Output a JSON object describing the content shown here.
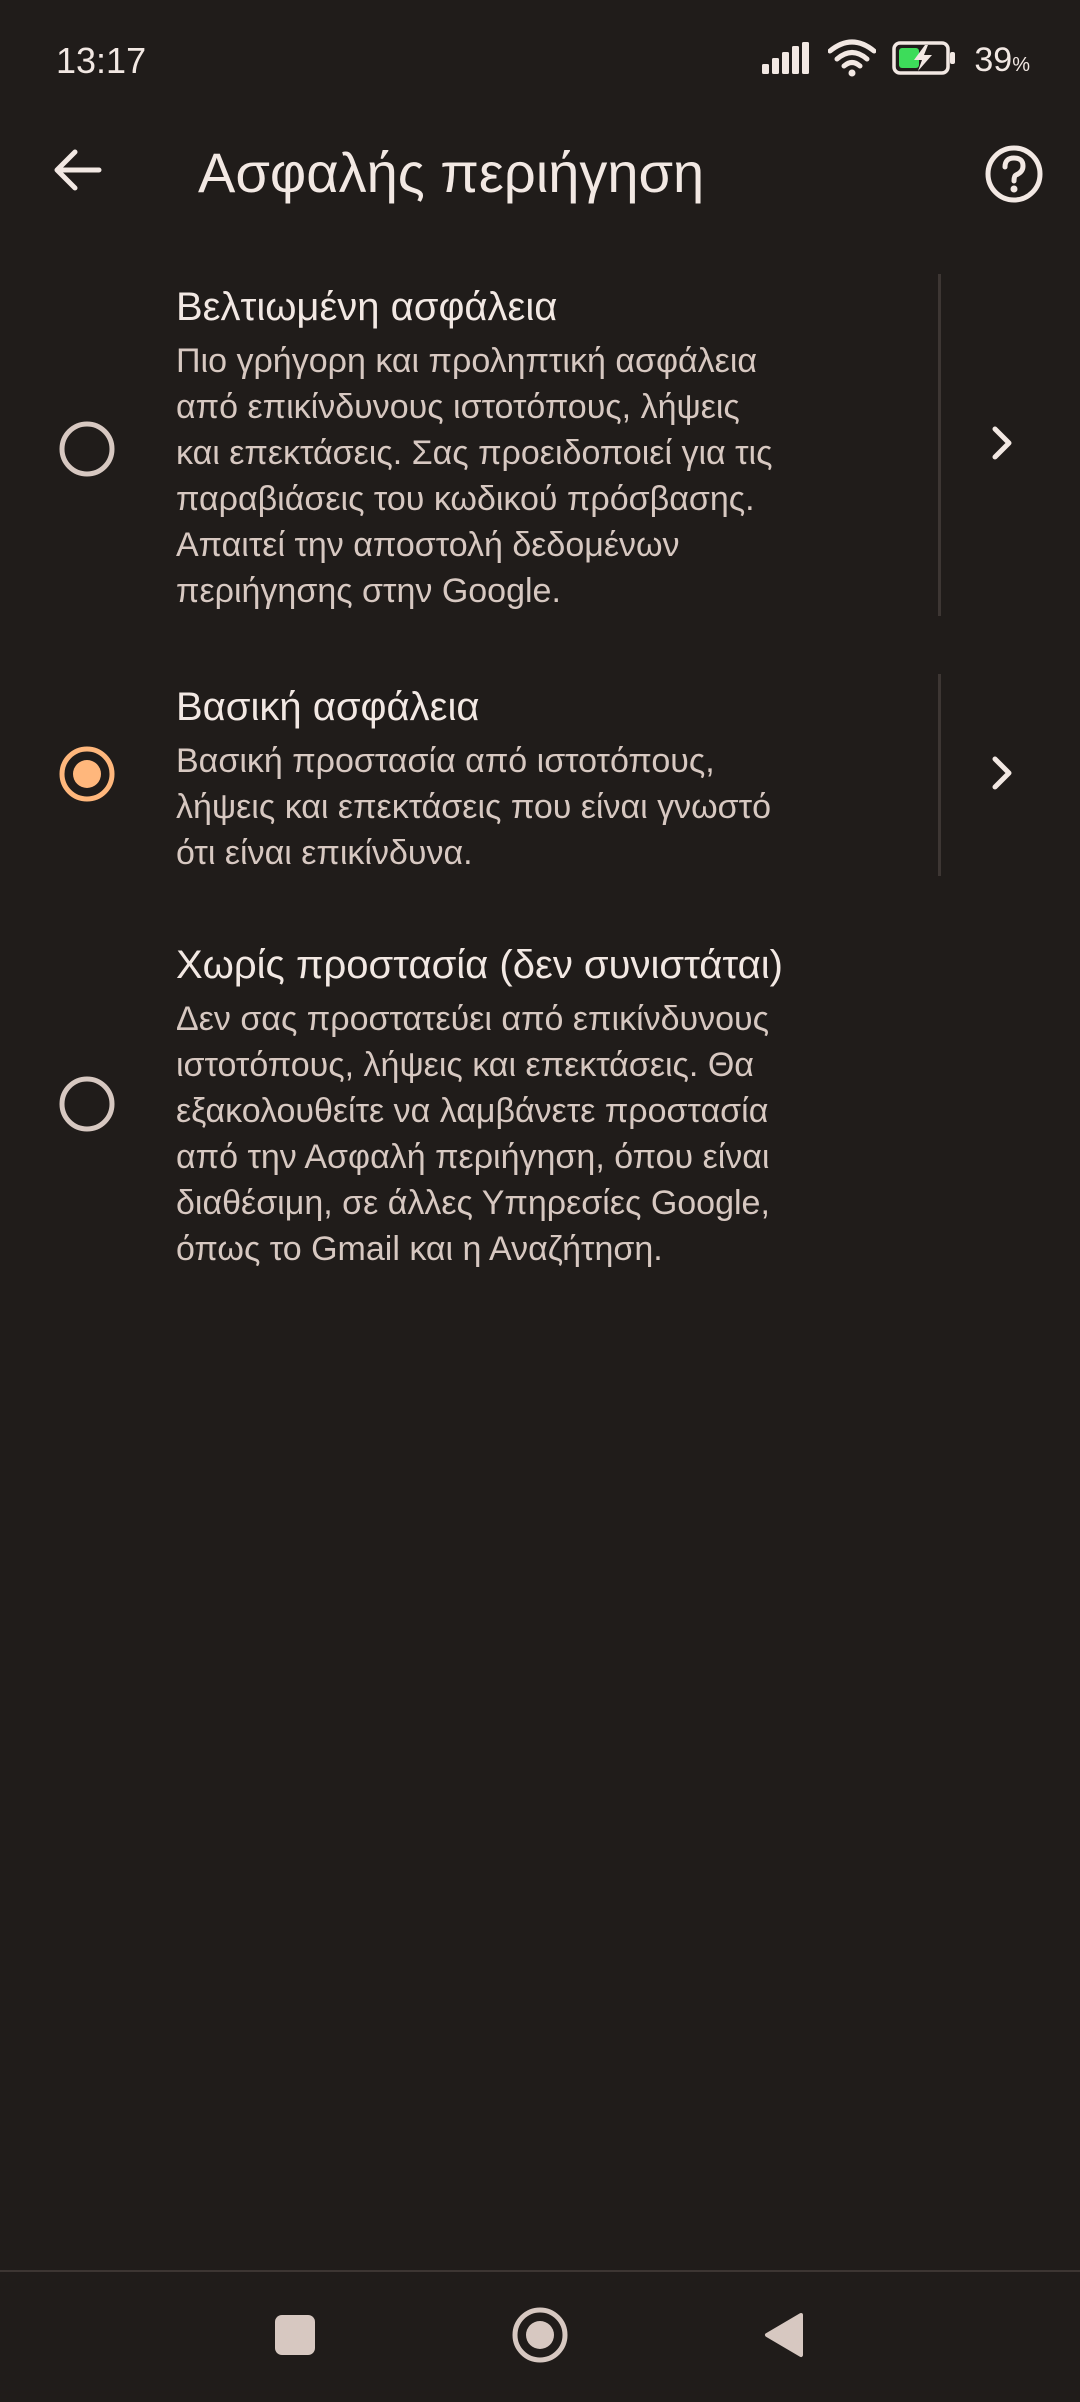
{
  "status_bar": {
    "time": "13:17",
    "battery_percent": "39",
    "battery_unit": "%"
  },
  "icons": {
    "back": "arrow-left-icon",
    "help": "help-circle-icon",
    "signal": "signal-icon",
    "wifi": "wifi-icon",
    "battery": "battery-charging-icon",
    "chevron": "chevron-right-icon",
    "nav_recents": "square-icon",
    "nav_home": "circle-icon",
    "nav_back": "triangle-back-icon"
  },
  "header": {
    "title": "Ασφαλής περιήγηση"
  },
  "options": [
    {
      "title": "Βελτιωμένη ασφάλεια",
      "lines": [
        "Πιο γρήγορη και προληπτική ασφάλεια",
        "από επικίνδυνους ιστοτόπους, λήψεις",
        "και επεκτάσεις. Σας προειδοποιεί για τις",
        "παραβιάσεις του κωδικού πρόσβασης.",
        "Απαιτεί την αποστολή δεδομένων",
        "περιήγησης στην Google."
      ],
      "selected": false
    },
    {
      "title": "Βασική ασφάλεια",
      "lines": [
        "Βασική προστασία από ιστοτόπους,",
        "λήψεις και επεκτάσεις που είναι γνωστό",
        "ότι είναι επικίνδυνα."
      ],
      "selected": true
    },
    {
      "title": "Χωρίς προστασία (δεν συνιστάται)",
      "lines": [
        "Δεν σας προστατεύει από επικίνδυνους",
        "ιστοτόπους, λήψεις και επεκτάσεις. Θα",
        "εξακολουθείτε να λαμβάνετε προστασία",
        "από την Ασφαλή περιήγηση, όπου είναι",
        "διαθέσιμη, σε άλλες Υπηρεσίες Google,",
        "όπως το Gmail και η Αναζήτηση."
      ],
      "selected": false
    }
  ],
  "colors": {
    "background": "#201c1a",
    "accent": "#ffb77c",
    "text_primary": "#f2e8e3",
    "text_secondary": "#d7c8c1"
  }
}
